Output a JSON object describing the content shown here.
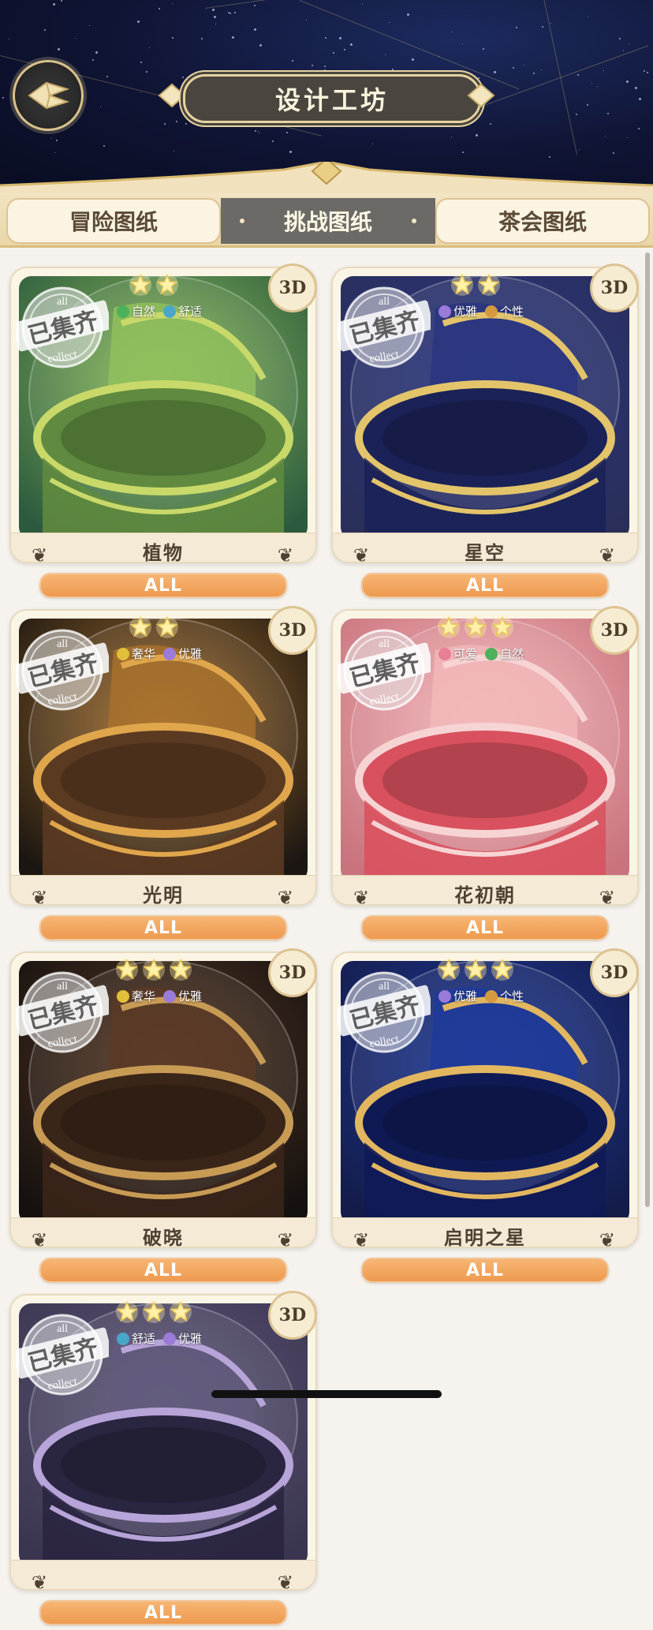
{
  "header": {
    "title": "设计工坊",
    "back_icon": "back-arrow-icon"
  },
  "tabs": [
    {
      "label": "冒险图纸",
      "active": false
    },
    {
      "label": "挑战图纸",
      "active": true
    },
    {
      "label": "茶会图纸",
      "active": false
    }
  ],
  "stamp": {
    "text": "已集齐",
    "top_word": "all",
    "bottom_word": "collect"
  },
  "badge_label": "3D",
  "all_label": "ALL",
  "cards": [
    {
      "name": "植物",
      "stars": 2,
      "tags": [
        "自然",
        "舒适"
      ],
      "tag_colors": [
        "#4cb15a",
        "#4aa7c9"
      ],
      "palette": [
        "#2c5a3e",
        "#8fbf5c",
        "#c8d96a",
        "#5f8a3f"
      ]
    },
    {
      "name": "星空",
      "stars": 2,
      "tags": [
        "优雅",
        "个性"
      ],
      "tag_colors": [
        "#9b7bd8",
        "#d59a3f"
      ],
      "palette": [
        "#2a2f5a",
        "#2a3580",
        "#e3c46a",
        "#1b2258"
      ]
    },
    {
      "name": "光明",
      "stars": 2,
      "tags": [
        "奢华",
        "优雅"
      ],
      "tag_colors": [
        "#e0bf3a",
        "#9b7bd8"
      ],
      "palette": [
        "#1b1612",
        "#a8712d",
        "#e0a64c",
        "#5b3a22"
      ]
    },
    {
      "name": "花初朝",
      "stars": 3,
      "tags": [
        "可爱",
        "自然"
      ],
      "tag_colors": [
        "#e87f94",
        "#4cb15a"
      ],
      "palette": [
        "#c9737f",
        "#f2b7b8",
        "#f7d4d4",
        "#d9515e"
      ]
    },
    {
      "name": "破晓",
      "stars": 3,
      "tags": [
        "奢华",
        "优雅"
      ],
      "tag_colors": [
        "#e0bf3a",
        "#9b7bd8"
      ],
      "palette": [
        "#15110f",
        "#5a3a26",
        "#c89b55",
        "#3a2519"
      ]
    },
    {
      "name": "启明之星",
      "stars": 3,
      "tags": [
        "优雅",
        "个性"
      ],
      "tag_colors": [
        "#9b7bd8",
        "#d59a3f"
      ],
      "palette": [
        "#141c4a",
        "#1f3a9a",
        "#e2b760",
        "#0f1a55"
      ]
    },
    {
      "name": "",
      "stars": 3,
      "tags": [
        "舒适",
        "优雅"
      ],
      "tag_colors": [
        "#4aa7c9",
        "#9b7bd8"
      ],
      "palette": [
        "#3a3550",
        "#615a7c",
        "#b7a4d8",
        "#2a2540"
      ]
    }
  ],
  "colors": {
    "accent_gold": "#dcc392",
    "all_button": "#ee9a4f",
    "active_tab": "#6c6a66"
  }
}
